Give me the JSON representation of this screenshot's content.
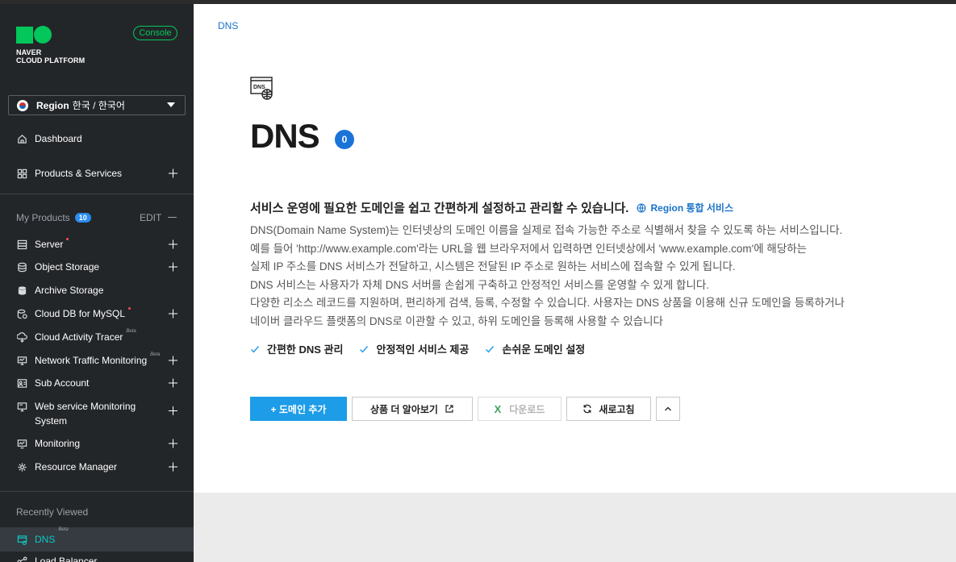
{
  "brand": {
    "logo_line1": "NAVER",
    "logo_line2": "CLOUD PLATFORM",
    "console_label": "Console",
    "accent": "#03c75a"
  },
  "region": {
    "label": "Region",
    "value": "한국 / 한국어"
  },
  "sidebar": {
    "dashboard": "Dashboard",
    "products_services": "Products & Services",
    "my_products": {
      "title": "My Products",
      "count": "10",
      "edit": "EDIT"
    },
    "items": [
      {
        "label": "Server",
        "icon": "server-icon",
        "marker": "red-dot",
        "has_plus": true
      },
      {
        "label": "Object Storage",
        "icon": "storage-icon",
        "has_plus": true
      },
      {
        "label": "Archive Storage",
        "icon": "archive-icon",
        "has_plus": false
      },
      {
        "label": "Cloud DB for MySQL",
        "icon": "database-icon",
        "marker": "red-dot",
        "has_plus": true
      },
      {
        "label": "Cloud Activity Tracer",
        "icon": "tracer-icon",
        "beta": "Beta",
        "has_plus": false
      },
      {
        "label": "Network Traffic Monitoring",
        "icon": "network-icon",
        "beta": "Beta",
        "has_plus": true
      },
      {
        "label": "Sub Account",
        "icon": "account-icon",
        "has_plus": true
      },
      {
        "label_line1": "Web service Monitoring",
        "label_line2": "System",
        "icon": "monitor-icon",
        "has_plus": true
      },
      {
        "label": "Monitoring",
        "icon": "monitoring-icon",
        "has_plus": true
      },
      {
        "label": "Resource Manager",
        "icon": "resource-icon",
        "has_plus": true
      }
    ],
    "recently_viewed": {
      "title": "Recently Viewed",
      "items": [
        {
          "label": "DNS",
          "beta": "Beta",
          "active": true
        },
        {
          "label": "Load Balancer"
        }
      ]
    }
  },
  "main": {
    "breadcrumb": "DNS",
    "title": "DNS",
    "count": "0",
    "headline": "서비스 운영에 필요한 도메인을 쉽고 간편하게 설정하고 관리할 수 있습니다.",
    "region_service": "Region 통합 서비스",
    "description": [
      "DNS(Domain Name System)는 인터넷상의 도메인 이름을 실제로 접속 가능한 주소로 식별해서 찾을 수 있도록 하는 서비스입니다.",
      "예를 들어 'http://www.example.com'라는 URL을 웹 브라우저에서 입력하면 인터넷상에서 'www.example.com'에 해당하는",
      "실제 IP 주소를 DNS 서비스가 전달하고, 시스템은 전달된 IP 주소로 원하는 서비스에 접속할 수 있게 됩니다.",
      "DNS 서비스는 사용자가 자체 DNS 서버를 손쉽게 구축하고 안정적인 서비스를 운영할 수 있게 합니다.",
      "다양한 리소스 레코드를 지원하며, 편리하게 검색, 등록, 수정할 수 있습니다. 사용자는 DNS 상품을 이용해 신규 도메인을 등록하거나",
      "네이버 클라우드 플랫폼의 DNS로 이관할 수 있고, 하위 도메인을 등록해 사용할 수 있습니다"
    ],
    "features": [
      "간편한 DNS 관리",
      "안정적인 서비스 제공",
      "손쉬운 도메인 설정"
    ],
    "buttons": {
      "add_domain": "+ 도메인 추가",
      "learn_more": "상품 더 알아보기",
      "download": "다운로드",
      "refresh": "새로고침"
    }
  }
}
